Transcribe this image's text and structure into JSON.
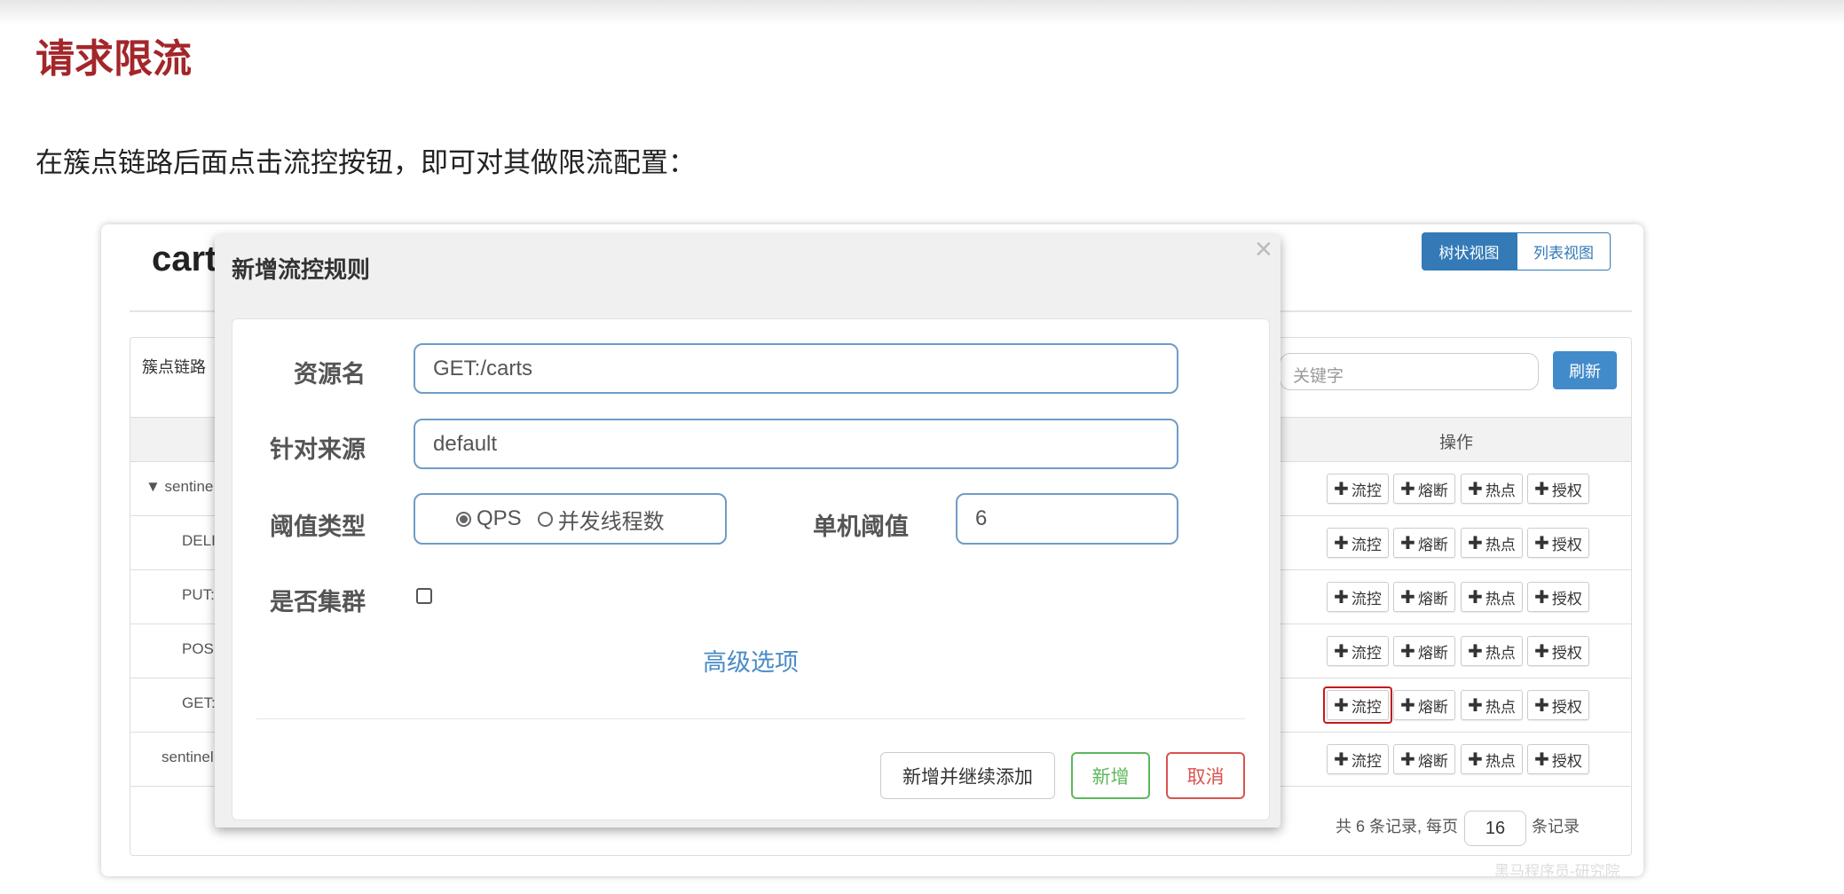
{
  "doc": {
    "heading": "请求限流",
    "paragraph": "在簇点链路后面点击流控按钮，即可对其做限流配置："
  },
  "panel": {
    "title": "cart",
    "view_tabs": [
      "树状视图",
      "列表视图"
    ],
    "chain_label": "簇点链路",
    "search_placeholder": "关键字",
    "refresh": "刷新",
    "col_ops": "操作",
    "rows": [
      {
        "label": "▼ sentine"
      },
      {
        "label": "DELI"
      },
      {
        "label": "PUT:"
      },
      {
        "label": "POS"
      },
      {
        "label": "GET:"
      },
      {
        "label": "sentinel"
      }
    ],
    "actions": [
      "流控",
      "熔断",
      "热点",
      "授权"
    ],
    "plus": "✚",
    "pager_prefix": "共 6 条记录, 每页",
    "page_size": "16",
    "pager_suffix": "条记录",
    "watermark": "黑马程序员-研究院"
  },
  "modal": {
    "title": "新增流控规则",
    "close": "×",
    "resource_label": "资源名",
    "resource_value": "GET:/carts",
    "origin_label": "针对来源",
    "origin_value": "default",
    "threshold_type_label": "阈值类型",
    "threshold_options": [
      "QPS",
      "并发线程数"
    ],
    "threshold_label": "单机阈值",
    "threshold_value": "6",
    "cluster_label": "是否集群",
    "advanced": "高级选项",
    "btn_add_continue": "新增并继续添加",
    "btn_add": "新增",
    "btn_cancel": "取消"
  },
  "colors": {
    "heading": "#a3262a",
    "primary": "#428bca",
    "success": "#5cb85c",
    "danger": "#d9534f",
    "highlight": "#c41a1a"
  }
}
